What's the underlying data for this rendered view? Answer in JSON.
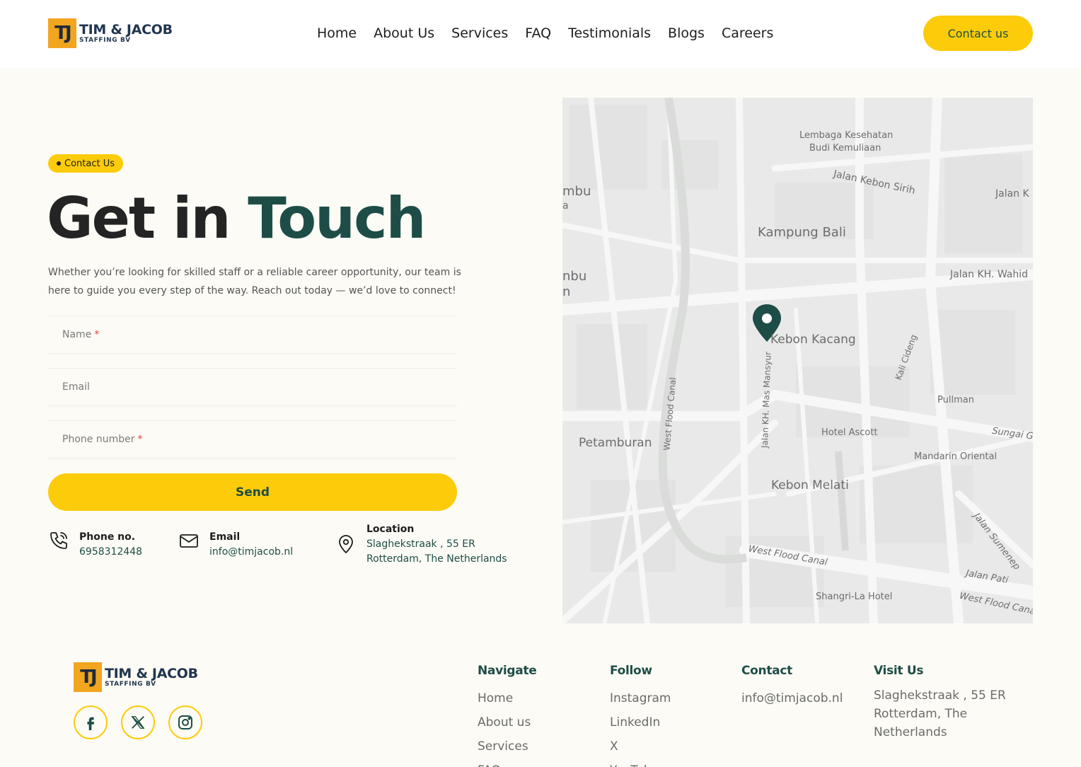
{
  "brand": {
    "mark": "TJ",
    "name": "TIM & JACOB",
    "sub": "STAFFING BV"
  },
  "nav": [
    "Home",
    "About Us",
    "Services",
    "FAQ",
    "Testimonials",
    "Blogs",
    "Careers"
  ],
  "header_cta": "Contact us",
  "hero": {
    "badge": "Contact Us",
    "title_part1": "Get in",
    "title_part2": "Touch",
    "lead": "Whether you’re looking for skilled staff or a reliable career opportunity, our team is here to guide you every step of the way. Reach out today — we’d love to connect!"
  },
  "form": {
    "name_placeholder": "Name",
    "email_placeholder": "Email",
    "phone_placeholder": "Phone number",
    "required_mark": "*",
    "submit": "Send"
  },
  "contact_info": {
    "phone_label": "Phone no.",
    "phone_value": "6958312448",
    "email_label": "Email",
    "email_value": "info@timjacob.nl",
    "location_label": "Location",
    "location_line1": "Slaghekstraak , 55 ER",
    "location_line2": "Rotterdam, The Netherlands"
  },
  "map": {
    "labels": [
      "Lembaga Kesehatan",
      "Budi Kemuliaan",
      "Jalan Kebon Sirih",
      "Jalan K",
      "mbu",
      "a",
      "Kampung Bali",
      "nbu",
      "n",
      "Jalan KH. Wahid",
      "Kebon Kacang",
      "Kali Cideng",
      "Pullman",
      "West Flood Canal",
      "Jalan KH. Mas Mansyur",
      "Petamburan",
      "Hotel Ascott",
      "Sungai Gi",
      "Mandarin Oriental",
      "Kebon Melati",
      "Jalan Sumenep",
      "West Flood Canal",
      "Jalan Pati",
      "Shangri-La Hotel",
      "West Flood Cana"
    ],
    "pin_color": "#1e4d47"
  },
  "footer": {
    "columns": [
      {
        "title": "Navigate",
        "items": [
          "Home",
          "About us",
          "Services",
          "FAQ"
        ]
      },
      {
        "title": "Follow",
        "items": [
          "Instagram",
          "LinkedIn",
          "X",
          "YouTube"
        ]
      },
      {
        "title": "Contact",
        "items": [
          "info@timjacob.nl"
        ]
      },
      {
        "title": "Visit Us",
        "items": [
          "Slaghekstraak , 55 ER Rotterdam, The Netherlands"
        ]
      }
    ],
    "social": [
      "facebook-icon",
      "x-icon",
      "instagram-icon"
    ]
  },
  "colors": {
    "accent": "#fccc0a",
    "brand_green": "#1e4d47",
    "logo_orange": "#f2a51f",
    "bg": "#fcfbf5"
  }
}
